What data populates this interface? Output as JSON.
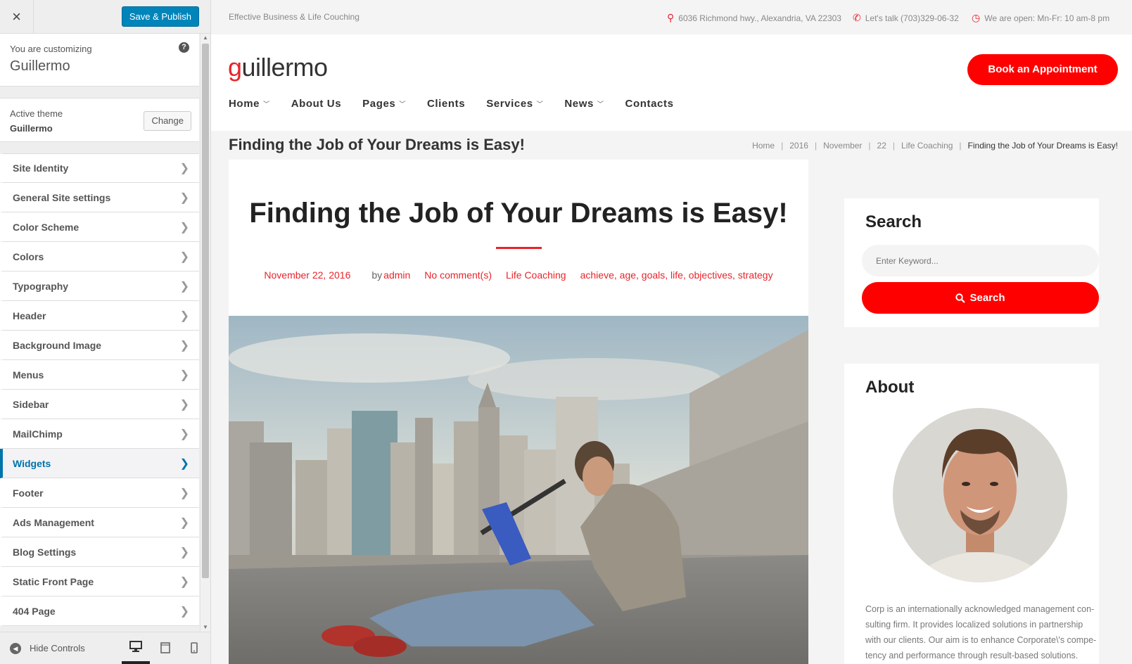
{
  "customizer": {
    "close_label": "×",
    "save_label": "Save & Publish",
    "customizing_label": "You are customizing",
    "site_name": "Guillermo",
    "help_icon": "?",
    "active_theme_label": "Active theme",
    "theme_name": "Guillermo",
    "change_label": "Change",
    "sections": [
      {
        "label": "Site Identity"
      },
      {
        "label": "General Site settings"
      },
      {
        "label": "Color Scheme"
      },
      {
        "label": "Colors"
      },
      {
        "label": "Typography"
      },
      {
        "label": "Header"
      },
      {
        "label": "Background Image"
      },
      {
        "label": "Menus"
      },
      {
        "label": "Sidebar"
      },
      {
        "label": "MailChimp"
      },
      {
        "label": "Widgets"
      },
      {
        "label": "Footer"
      },
      {
        "label": "Ads Management"
      },
      {
        "label": "Blog Settings"
      },
      {
        "label": "Static Front Page"
      },
      {
        "label": "404 Page"
      }
    ],
    "active_section": "Widgets",
    "hide_controls_label": "Hide Controls",
    "devices": [
      "desktop-icon",
      "tablet-icon",
      "mobile-icon"
    ],
    "active_device": "desktop"
  },
  "site": {
    "tagline": "Effective Business & Life Couching",
    "address": "6036 Richmond hwy., Alexandria, VA 22303",
    "phone": "Let's talk (703)329-06-32",
    "hours": "We are open: Mn-Fr: 10 am-8 pm",
    "logo_first": "g",
    "logo_rest": "uillermo",
    "book_label": "Book an Appointment",
    "nav": [
      {
        "label": "Home",
        "dropdown": true
      },
      {
        "label": "About Us",
        "dropdown": false
      },
      {
        "label": "Pages",
        "dropdown": true
      },
      {
        "label": "Clients",
        "dropdown": false
      },
      {
        "label": "Services",
        "dropdown": true
      },
      {
        "label": "News",
        "dropdown": true
      },
      {
        "label": "Contacts",
        "dropdown": false
      }
    ],
    "accent_color": "#ff0000"
  },
  "page": {
    "title": "Finding the Job of Your Dreams is Easy!",
    "breadcrumbs": [
      "Home",
      "2016",
      "November",
      "22",
      "Life Coaching"
    ],
    "breadcrumb_current": "Finding the Job of Your Dreams is Easy!"
  },
  "post": {
    "title": "Finding the Job of Your Dreams is Easy!",
    "date": "November 22, 2016",
    "by_label": "by",
    "author": "admin",
    "comments": "No comment(s)",
    "category": "Life Coaching",
    "tags": [
      "achieve",
      "age",
      "goals",
      "life",
      "objectives",
      "strategy"
    ]
  },
  "sidebar": {
    "search_title": "Search",
    "search_placeholder": "Enter Keyword...",
    "search_button": "Search",
    "about_title": "About",
    "about_text": "Corp is an internationally acknowledged management con-sulting firm. It provides localized solutions in partnership with our clients. Our aim is to enhance Corporate\\'s compe-tency and performance through result-based solutions."
  }
}
